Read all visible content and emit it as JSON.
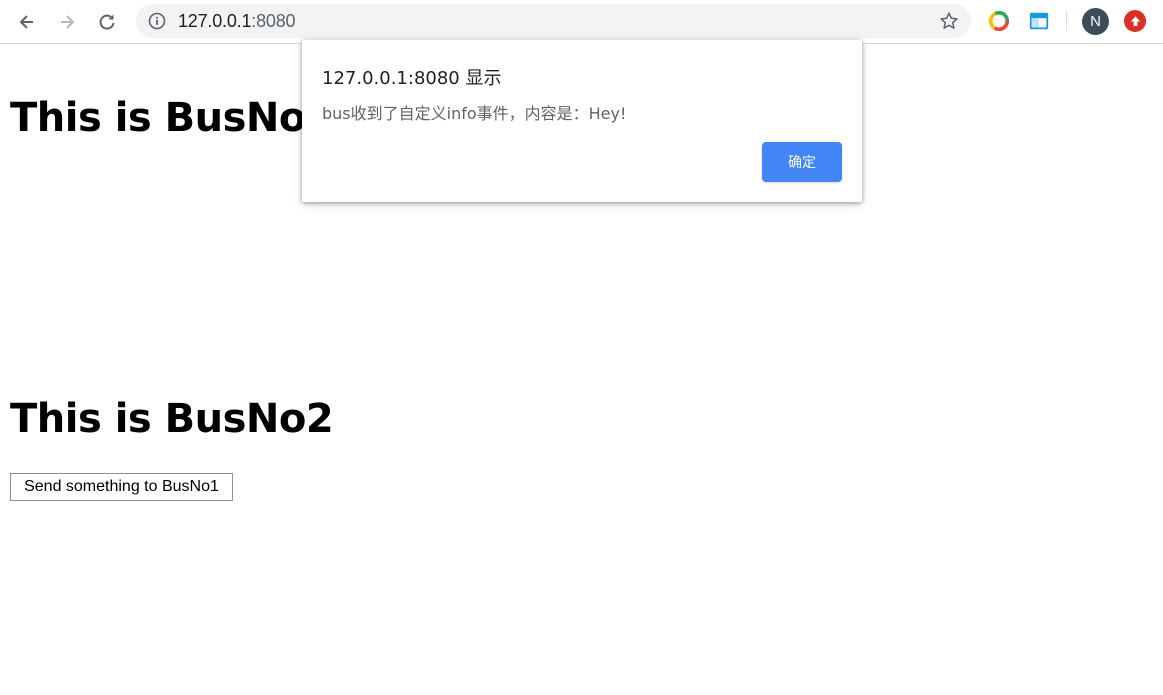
{
  "browser": {
    "url_host": "127.0.0.1",
    "url_port": ":8080",
    "profile_initial": "N"
  },
  "page": {
    "heading_1": "This is BusNo1",
    "heading_2": "This is BusNo2",
    "send_button_label": "Send something to BusNo1"
  },
  "dialog": {
    "title": "127.0.0.1:8080 显示",
    "message": "bus收到了自定义info事件，内容是：Hey!",
    "ok_label": "确定"
  },
  "colors": {
    "accent": "#4285f4",
    "avatar_bg": "#3c4d59",
    "upgrade_badge": "#d93025"
  },
  "icons": [
    "back-icon",
    "forward-icon",
    "reload-icon",
    "info-icon",
    "star-icon",
    "chrome-ext-icon",
    "window-ext-icon",
    "profile-avatar",
    "update-icon"
  ]
}
